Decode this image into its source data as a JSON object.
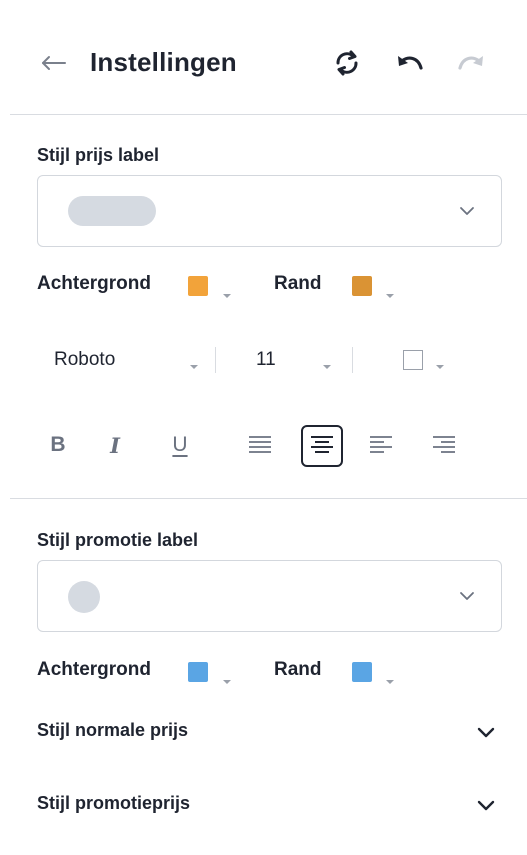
{
  "header": {
    "title": "Instellingen",
    "icons": [
      "back-arrow-icon",
      "sync-icon",
      "undo-icon",
      "redo-icon"
    ]
  },
  "price_label": {
    "section_title": "Stijl prijs label",
    "preview_shape": "pill",
    "background_label": "Achtergrond",
    "background_color": "#F2A33A",
    "border_label": "Rand",
    "border_color": "#DA9334"
  },
  "font_toolbar": {
    "font_family": "Roboto",
    "font_size": "11",
    "text_color": "#FFFFFF"
  },
  "format_toolbar": {
    "buttons": {
      "bold": "B",
      "italic": "I",
      "underline": "U"
    },
    "active_alignment": "center"
  },
  "promo_label": {
    "section_title": "Stijl promotie label",
    "preview_shape": "circle",
    "background_label": "Achtergrond",
    "background_color": "#5AA5E4",
    "border_label": "Rand",
    "border_color": "#5AA5E4"
  },
  "collapsibles": [
    {
      "label": "Stijl normale prijs"
    },
    {
      "label": "Stijl promotieprijs"
    }
  ],
  "colors": {
    "text": "#1F2430",
    "muted_icon": "#7A808C",
    "divider": "#D9DCE1",
    "preview_gray": "#D5DAE1"
  }
}
